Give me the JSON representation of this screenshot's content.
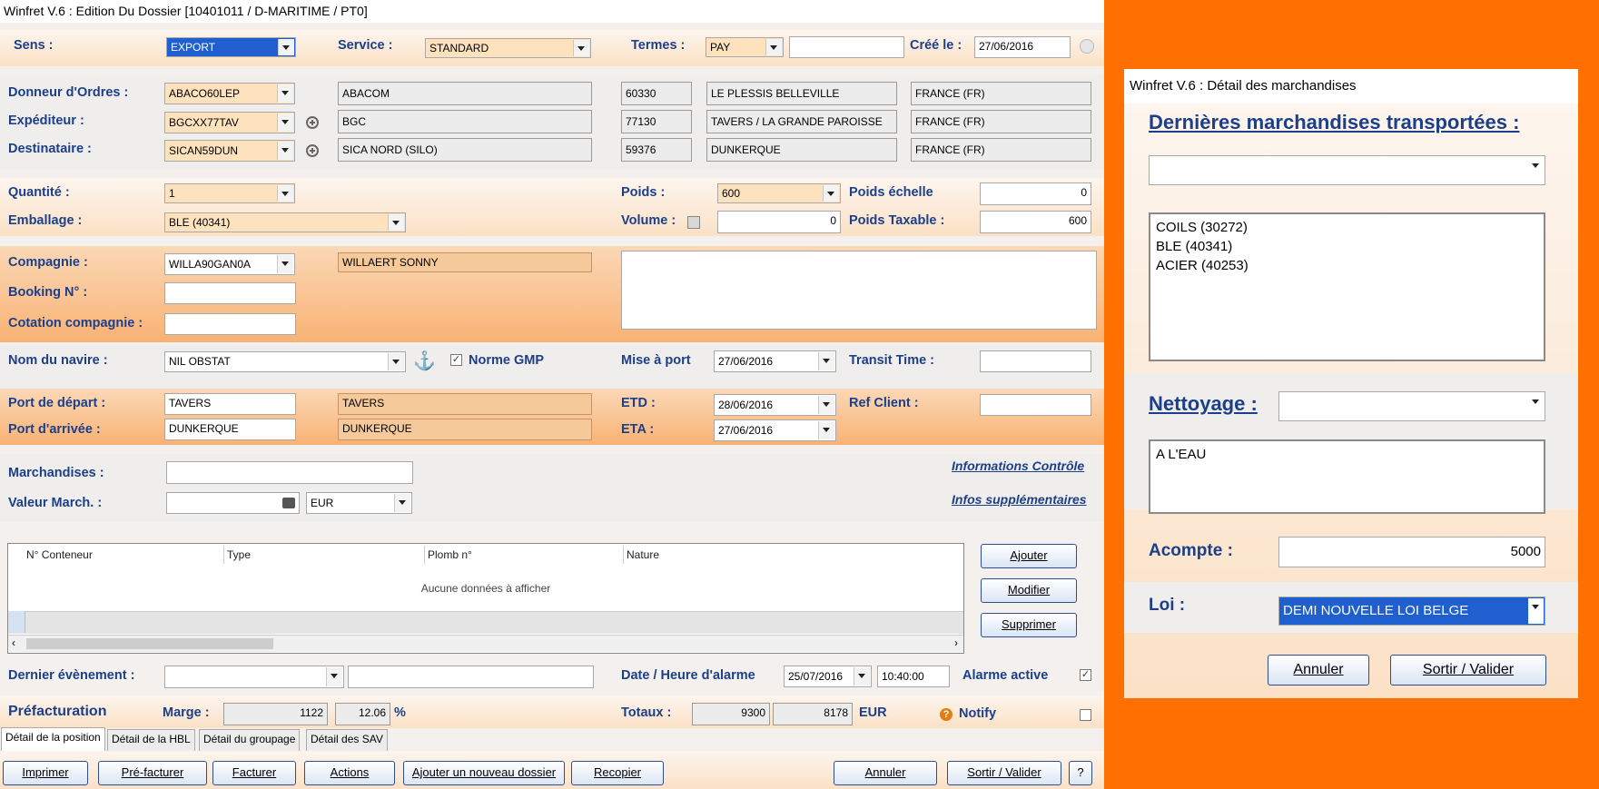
{
  "main": {
    "window_title": "Winfret V.6 : Edition Du Dossier [10401011 / D-MARITIME / PT0]",
    "header": {
      "sens_label": "Sens :",
      "sens_value": "EXPORT",
      "service_label": "Service :",
      "service_value": "STANDARD",
      "termes_label": "Termes :",
      "termes_value": "PAY",
      "termes_extra": "",
      "cree_label": "Créé le :",
      "cree_value": "27/06/2016"
    },
    "parties": {
      "donneur_label": "Donneur d'Ordres :",
      "expediteur_label": "Expéditeur :",
      "destinataire_label": "Destinataire :",
      "rows": [
        {
          "code": "ABACO60LEP",
          "name": "ABACOM",
          "cp": "60330",
          "city": "LE PLESSIS BELLEVILLE",
          "country": "FRANCE (FR)"
        },
        {
          "code": "BGCXX77TAV",
          "name": "BGC",
          "cp": "77130",
          "city": "TAVERS / LA GRANDE PAROISSE",
          "country": "FRANCE (FR)"
        },
        {
          "code": "SICAN59DUN",
          "name": "SICA NORD (SILO)",
          "cp": "59376",
          "city": "DUNKERQUE",
          "country": "FRANCE (FR)"
        }
      ]
    },
    "cargo": {
      "quantite_label": "Quantité :",
      "quantite_value": "1",
      "emballage_label": "Emballage :",
      "emballage_value": "BLE (40341)",
      "poids_label": "Poids :",
      "poids_value": "600",
      "volume_label": "Volume :",
      "volume_value": "0",
      "poids_echelle_label": "Poids échelle",
      "poids_echelle_value": "0",
      "poids_taxable_label": "Poids Taxable :",
      "poids_taxable_value": "600"
    },
    "compagnie": {
      "compagnie_label": "Compagnie :",
      "compagnie_code": "WILLA90GAN0A",
      "compagnie_name": "WILLAERT SONNY",
      "booking_label": "Booking N° :",
      "booking_value": "",
      "cotation_label": "Cotation compagnie :",
      "cotation_value": "",
      "notes": ""
    },
    "navire": {
      "nom_label": "Nom du navire :",
      "nom_value": "NIL OBSTAT",
      "norme_label": "Norme GMP",
      "norme_checked": "✓",
      "mise_label": "Mise à port",
      "mise_value": "27/06/2016",
      "transit_label": "Transit Time :",
      "transit_value": ""
    },
    "ports": {
      "depart_label": "Port de départ :",
      "depart_code": "TAVERS",
      "depart_name": "TAVERS",
      "arrivee_label": "Port d'arrivée :",
      "arrivee_code": "DUNKERQUE",
      "arrivee_name": "DUNKERQUE",
      "etd_label": "ETD :",
      "etd_value": "28/06/2016",
      "eta_label": "ETA :",
      "eta_value": "27/06/2016",
      "ref_label": "Ref Client :",
      "ref_value": ""
    },
    "march": {
      "marchandises_label": "Marchandises :",
      "marchandises_value": "",
      "valeur_label": "Valeur March. :",
      "valeur_value": "",
      "devise": "EUR",
      "info_controle": "Informations Contrôle",
      "info_supp": "Infos supplémentaires"
    },
    "containers": {
      "columns": [
        "N° Conteneur",
        "Type",
        "Plomb n°",
        "Nature"
      ],
      "empty_text": "Aucune données à afficher",
      "add": "Ajouter",
      "edit": "Modifier",
      "delete": "Supprimer"
    },
    "evenement": {
      "dernier_label": "Dernier évènement :",
      "dernier_value": "",
      "dernier_text": "",
      "alarme_label": "Date / Heure d'alarme",
      "alarme_date": "25/07/2016",
      "alarme_time": "10:40:00",
      "alarme_active_label": "Alarme active",
      "alarme_active_mark": "✓"
    },
    "prefact": {
      "title": "Préfacturation",
      "marge_label": "Marge :",
      "marge_value": "1122",
      "marge_pct": "12.06",
      "pct_sign": "%",
      "totaux_label": "Totaux :",
      "total1": "9300",
      "total2": "8178",
      "devise": "EUR",
      "notify_label": "Notify"
    },
    "tabs": [
      "Détail de la position",
      "Détail de la HBL",
      "Détail du groupage",
      "Détail des SAV"
    ],
    "buttons": {
      "imprimer": "Imprimer",
      "prefacturer": "Pré-facturer",
      "facturer": "Facturer",
      "actions": "Actions",
      "ajouter_dossier": "Ajouter un nouveau dossier",
      "recopier": "Recopier",
      "annuler": "Annuler",
      "sortir": "Sortir / Valider",
      "help": "?"
    }
  },
  "side": {
    "window_title": "Winfret V.6 : Détail des marchandises",
    "dernieres_label": "Dernières marchandises transportées :",
    "dernieres_select": "",
    "items": [
      "COILS (30272)",
      "BLE (40341)",
      "ACIER (40253)"
    ],
    "nettoyage_label": "Nettoyage :",
    "nettoyage_select": "",
    "nettoyage_text": "A L'EAU",
    "acompte_label": "Acompte :",
    "acompte_value": "5000",
    "loi_label": "Loi :",
    "loi_value": "DEMI NOUVELLE LOI BELGE",
    "annuler": "Annuler",
    "sortir": "Sortir / Valider"
  },
  "colors": {
    "orange_bg": "#ff7000",
    "label_blue": "#1c3f8a",
    "field_orange": "#fde2bd"
  }
}
